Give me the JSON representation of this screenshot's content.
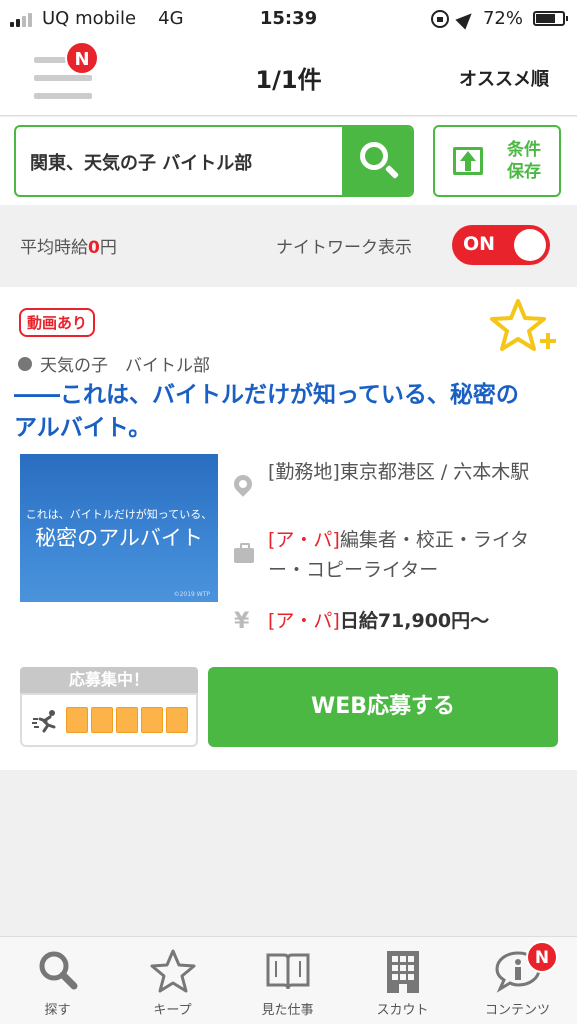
{
  "status_bar": {
    "carrier": "UQ mobile",
    "network": "4G",
    "time": "15:39",
    "battery": "72%",
    "battery_level": 0.72
  },
  "header": {
    "menu_badge": "N",
    "result_count": "1/1件",
    "sort_label": "オススメ順"
  },
  "search": {
    "query": "関東、天気の子 バイトル部",
    "save_label_line1": "条件",
    "save_label_line2": "保存"
  },
  "filters": {
    "avg_prefix": "平均時給",
    "avg_value": "0",
    "avg_unit": "円",
    "night_work_label": "ナイトワーク表示",
    "night_work_toggle": "ON"
  },
  "job": {
    "video_badge": "動画あり",
    "company": "天気の子　バイトル部",
    "title": "――これは、バイトルだけが知っている、秘密のアルバイト。",
    "image_line1": "これは、バイトルだけが知っている、",
    "image_line2": "秘密のアルバイト",
    "image_credit": "©2019 WTP",
    "location": "[勤務地]東京都港区 / 六本木駅",
    "job_type_tag": "[ア・パ]",
    "job_type": "編集者・校正・ライター・コピーライター",
    "salary_tag": "[ア・パ]",
    "salary": "日給71,900円～",
    "recruit_label": "応募集中！",
    "recruit_level": 5,
    "apply_label": "WEB応募する"
  },
  "tabbar": {
    "tabs": [
      {
        "label": "探す",
        "icon": "search-icon"
      },
      {
        "label": "キープ",
        "icon": "star-icon"
      },
      {
        "label": "見た仕事",
        "icon": "book-icon"
      },
      {
        "label": "スカウト",
        "icon": "building-icon"
      },
      {
        "label": "コンテンツ",
        "icon": "info-bubble-icon",
        "badge": "N"
      }
    ]
  },
  "colors": {
    "brand_green": "#4cb844",
    "accent_red": "#e8232c",
    "link_blue": "#1a60c4",
    "meter_orange": "#fbb34a"
  }
}
